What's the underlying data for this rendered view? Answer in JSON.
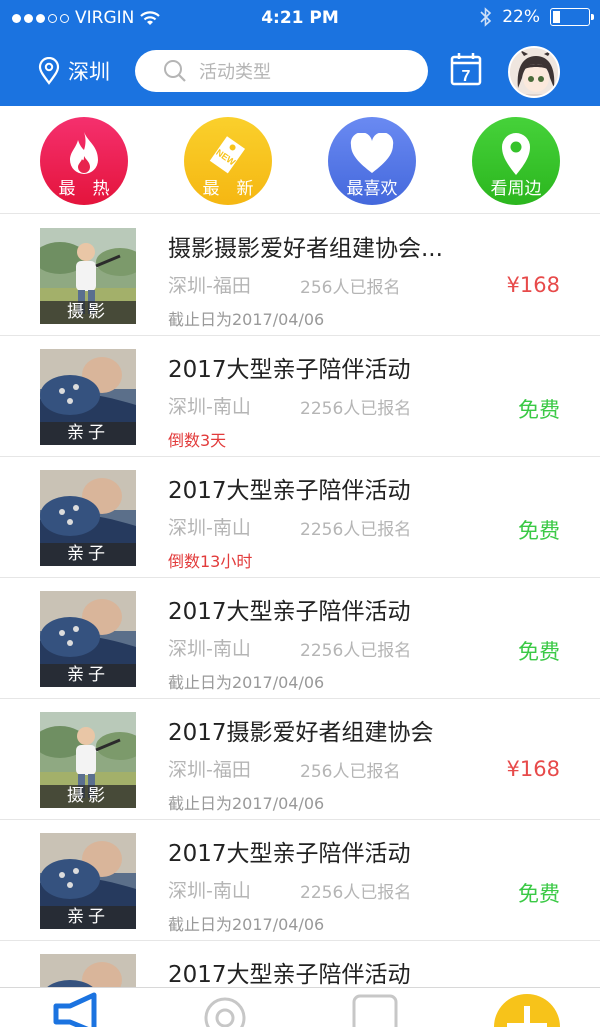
{
  "status_bar": {
    "carrier": "VIRGIN",
    "time": "4:21 PM",
    "battery": "22%",
    "battery_level": 0.22,
    "icons": [
      "signal-dots-icon",
      "wifi-icon",
      "bluetooth-icon",
      "battery-icon"
    ]
  },
  "nav": {
    "city": "深圳",
    "search_placeholder": "活动类型",
    "calendar_day": "7"
  },
  "categories": [
    {
      "label": "最　热",
      "icon": "flame-icon",
      "color_top": "#f5306e",
      "color_bottom": "#e4143c"
    },
    {
      "label": "最　新",
      "icon": "new-tag-icon",
      "color_top": "#fad02c",
      "color_bottom": "#f5b712"
    },
    {
      "label": "最喜欢",
      "icon": "heart-icon",
      "color_top": "#6a8af2",
      "color_bottom": "#4468dc"
    },
    {
      "label": "看周边",
      "icon": "map-pin-icon",
      "color_top": "#46d23a",
      "color_bottom": "#2bb61e"
    }
  ],
  "events": [
    {
      "title": "摄影摄影爱好者组建协会...",
      "place": "深圳-福田",
      "count": "256人已报名",
      "price": "¥168",
      "price_type": "paid",
      "note": "截止日为2017/04/06",
      "note_type": "normal",
      "tag": "摄影",
      "image": "child-photo"
    },
    {
      "title": "2017大型亲子陪伴活动",
      "place": "深圳-南山",
      "count": "2256人已报名",
      "price": "免费",
      "price_type": "free",
      "note": "倒数3天",
      "note_type": "alert",
      "tag": "亲子",
      "image": "parent-photo"
    },
    {
      "title": "2017大型亲子陪伴活动",
      "place": "深圳-南山",
      "count": "2256人已报名",
      "price": "免费",
      "price_type": "free",
      "note": "倒数13小时",
      "note_type": "alert",
      "tag": "亲子",
      "image": "parent-photo"
    },
    {
      "title": "2017大型亲子陪伴活动",
      "place": "深圳-南山",
      "count": "2256人已报名",
      "price": "免费",
      "price_type": "free",
      "note": "截止日为2017/04/06",
      "note_type": "normal",
      "tag": "亲子",
      "image": "parent-photo"
    },
    {
      "title": "2017摄影爱好者组建协会",
      "place": "深圳-福田",
      "count": "256人已报名",
      "price": "¥168",
      "price_type": "paid",
      "note": "截止日为2017/04/06",
      "note_type": "normal",
      "tag": "摄影",
      "image": "child-photo"
    },
    {
      "title": "2017大型亲子陪伴活动",
      "place": "深圳-南山",
      "count": "2256人已报名",
      "price": "免费",
      "price_type": "free",
      "note": "截止日为2017/04/06",
      "note_type": "normal",
      "tag": "亲子",
      "image": "parent-photo"
    },
    {
      "title": "2017大型亲子陪伴活动",
      "place": "",
      "count": "",
      "price": "",
      "price_type": "free",
      "note": "",
      "note_type": "normal",
      "tag": "",
      "image": "parent-photo"
    }
  ],
  "tabbar": {
    "icons": [
      "megaphone-icon",
      "discover-icon",
      "square-icon",
      "add-icon"
    ],
    "accent": "#1b73e0",
    "fab_color": "#f7c31a"
  },
  "colors": {
    "header": "#1b73e0",
    "price_paid": "#e74a4a",
    "price_free": "#3ac945",
    "alert": "#e23b3b"
  }
}
